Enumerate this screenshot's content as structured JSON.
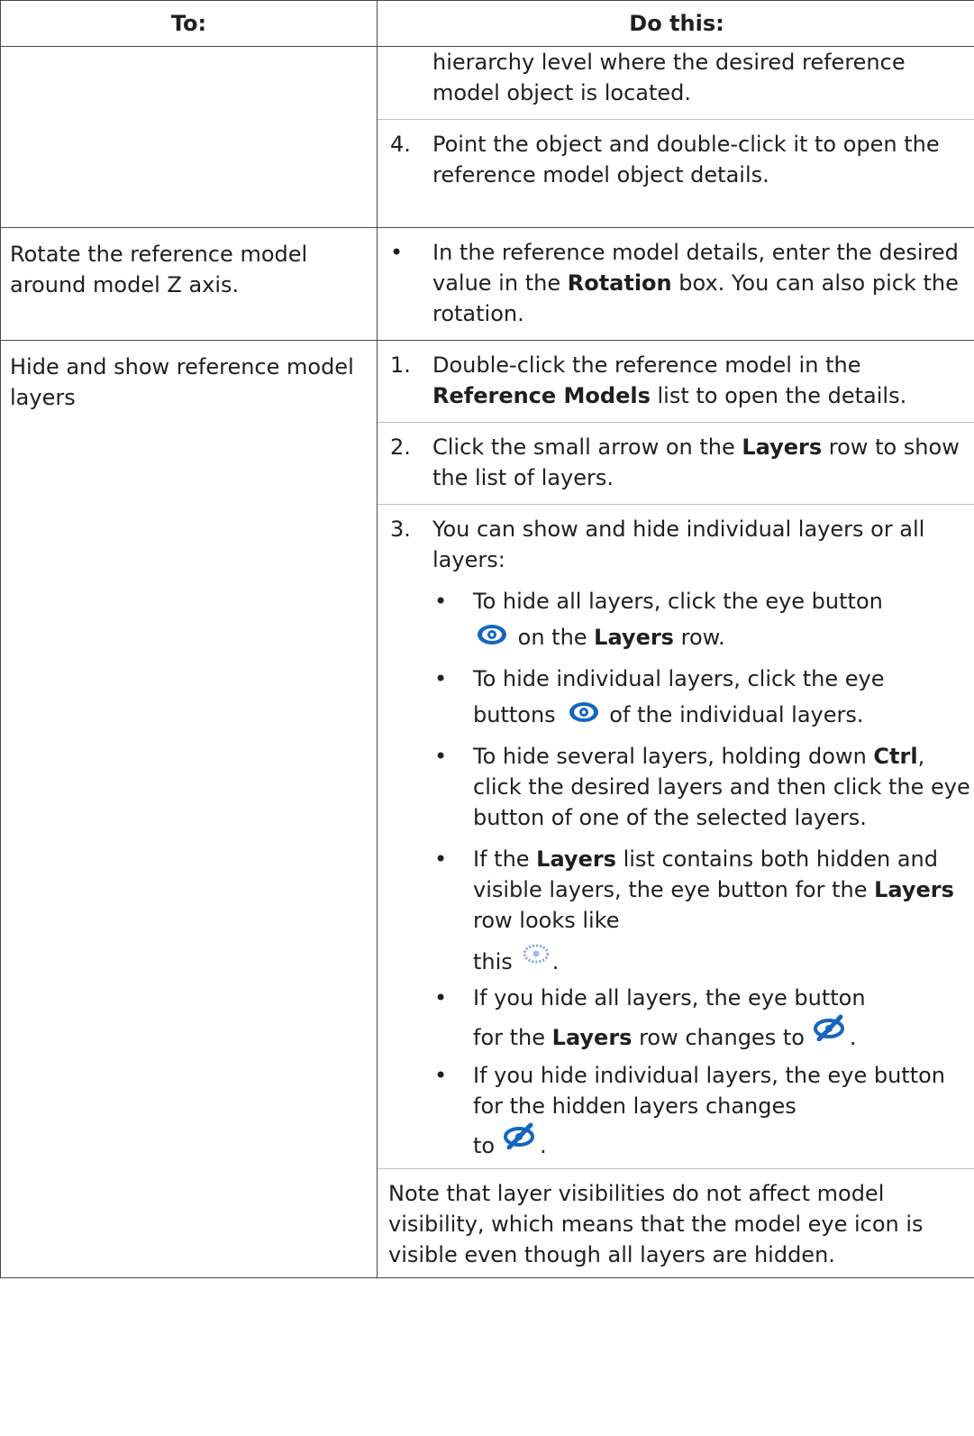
{
  "table": {
    "header_to": "To:",
    "header_do": "Do this:"
  },
  "row1": {
    "item_continuation": "hierarchy level where the desired reference model object is located.",
    "item4_marker": "4.",
    "item4_text": "Point the object and double-click it to open the reference model object details."
  },
  "row2": {
    "to": "Rotate the reference model around model Z axis.",
    "bullet": "•",
    "text_a": "In the reference model details, enter the desired value in the ",
    "text_bold": "Rotation",
    "text_b": " box. You can also pick the rotation."
  },
  "row3": {
    "to": "Hide and show reference model layers",
    "step1_marker": "1.",
    "step1_a": "Double-click the reference model in the ",
    "step1_bold": "Reference Models",
    "step1_b": " list to open the details.",
    "step2_marker": "2.",
    "step2_a": "Click the small arrow on the ",
    "step2_bold": "Layers",
    "step2_b": " row to show the list of layers.",
    "step3_marker": "3.",
    "step3_text": "You can show and hide individual layers or all layers:",
    "bullet": "•",
    "sub1_a": "To hide all layers, click the eye button",
    "sub1_b": " on the ",
    "sub1_bold": "Layers",
    "sub1_c": " row.",
    "sub2_a": "To hide individual layers, click the eye",
    "sub2_b": "buttons",
    "sub2_c": " of the individual layers.",
    "sub3_a": "To hide several layers, holding down ",
    "sub3_bold": "Ctrl",
    "sub3_b": ", click the desired layers and then click the eye button of one of the selected layers.",
    "sub4_a": "If the ",
    "sub4_bold1": "Layers",
    "sub4_b": " list contains both hidden and visible layers, the eye button for the ",
    "sub4_bold2": "Layers",
    "sub4_c": " row looks like",
    "sub4_d": "this",
    "sub4_e": ".",
    "sub5_a": "If you hide all layers, the eye button",
    "sub5_b": "for the ",
    "sub5_bold": "Layers",
    "sub5_c": " row changes to",
    "sub5_d": ".",
    "sub6_a": "If you hide individual layers, the eye button for the hidden layers changes",
    "sub6_b": "to",
    "sub6_c": ".",
    "note": "Note that layer visibilities do not affect model visibility, which means that the model eye icon is visible even though all layers are hidden."
  },
  "icons": {
    "eye": "eye-icon",
    "eye_partial": "eye-partial-icon",
    "eye_hidden": "eye-hidden-icon",
    "accent": "#1565c0"
  }
}
